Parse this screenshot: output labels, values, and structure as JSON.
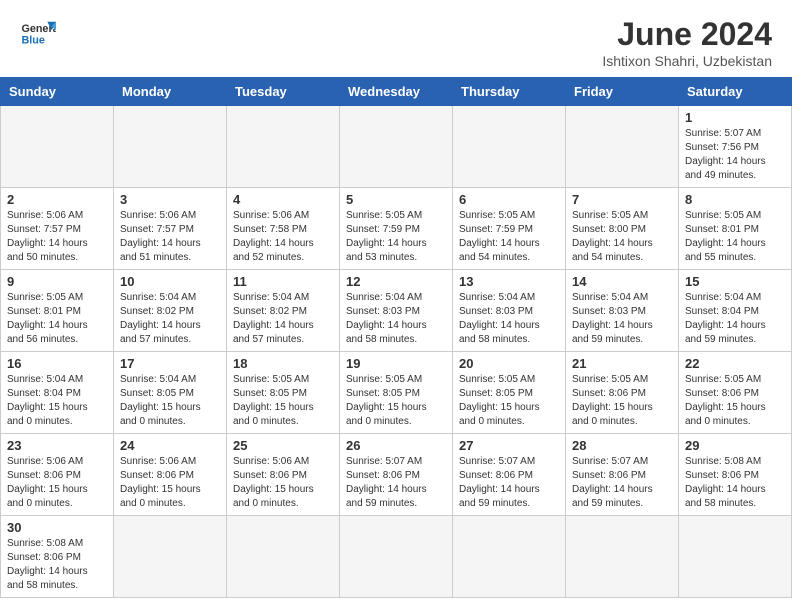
{
  "header": {
    "logo_general": "General",
    "logo_blue": "Blue",
    "title": "June 2024",
    "subtitle": "Ishtixon Shahri, Uzbekistan"
  },
  "weekdays": [
    "Sunday",
    "Monday",
    "Tuesday",
    "Wednesday",
    "Thursday",
    "Friday",
    "Saturday"
  ],
  "weeks": [
    [
      {
        "day": "",
        "info": ""
      },
      {
        "day": "",
        "info": ""
      },
      {
        "day": "",
        "info": ""
      },
      {
        "day": "",
        "info": ""
      },
      {
        "day": "",
        "info": ""
      },
      {
        "day": "",
        "info": ""
      },
      {
        "day": "1",
        "info": "Sunrise: 5:07 AM\nSunset: 7:56 PM\nDaylight: 14 hours and 49 minutes."
      }
    ],
    [
      {
        "day": "2",
        "info": "Sunrise: 5:06 AM\nSunset: 7:57 PM\nDaylight: 14 hours and 50 minutes."
      },
      {
        "day": "3",
        "info": "Sunrise: 5:06 AM\nSunset: 7:57 PM\nDaylight: 14 hours and 51 minutes."
      },
      {
        "day": "4",
        "info": "Sunrise: 5:06 AM\nSunset: 7:58 PM\nDaylight: 14 hours and 52 minutes."
      },
      {
        "day": "5",
        "info": "Sunrise: 5:05 AM\nSunset: 7:59 PM\nDaylight: 14 hours and 53 minutes."
      },
      {
        "day": "6",
        "info": "Sunrise: 5:05 AM\nSunset: 7:59 PM\nDaylight: 14 hours and 54 minutes."
      },
      {
        "day": "7",
        "info": "Sunrise: 5:05 AM\nSunset: 8:00 PM\nDaylight: 14 hours and 54 minutes."
      },
      {
        "day": "8",
        "info": "Sunrise: 5:05 AM\nSunset: 8:01 PM\nDaylight: 14 hours and 55 minutes."
      }
    ],
    [
      {
        "day": "9",
        "info": "Sunrise: 5:05 AM\nSunset: 8:01 PM\nDaylight: 14 hours and 56 minutes."
      },
      {
        "day": "10",
        "info": "Sunrise: 5:04 AM\nSunset: 8:02 PM\nDaylight: 14 hours and 57 minutes."
      },
      {
        "day": "11",
        "info": "Sunrise: 5:04 AM\nSunset: 8:02 PM\nDaylight: 14 hours and 57 minutes."
      },
      {
        "day": "12",
        "info": "Sunrise: 5:04 AM\nSunset: 8:03 PM\nDaylight: 14 hours and 58 minutes."
      },
      {
        "day": "13",
        "info": "Sunrise: 5:04 AM\nSunset: 8:03 PM\nDaylight: 14 hours and 58 minutes."
      },
      {
        "day": "14",
        "info": "Sunrise: 5:04 AM\nSunset: 8:03 PM\nDaylight: 14 hours and 59 minutes."
      },
      {
        "day": "15",
        "info": "Sunrise: 5:04 AM\nSunset: 8:04 PM\nDaylight: 14 hours and 59 minutes."
      }
    ],
    [
      {
        "day": "16",
        "info": "Sunrise: 5:04 AM\nSunset: 8:04 PM\nDaylight: 15 hours and 0 minutes."
      },
      {
        "day": "17",
        "info": "Sunrise: 5:04 AM\nSunset: 8:05 PM\nDaylight: 15 hours and 0 minutes."
      },
      {
        "day": "18",
        "info": "Sunrise: 5:05 AM\nSunset: 8:05 PM\nDaylight: 15 hours and 0 minutes."
      },
      {
        "day": "19",
        "info": "Sunrise: 5:05 AM\nSunset: 8:05 PM\nDaylight: 15 hours and 0 minutes."
      },
      {
        "day": "20",
        "info": "Sunrise: 5:05 AM\nSunset: 8:05 PM\nDaylight: 15 hours and 0 minutes."
      },
      {
        "day": "21",
        "info": "Sunrise: 5:05 AM\nSunset: 8:06 PM\nDaylight: 15 hours and 0 minutes."
      },
      {
        "day": "22",
        "info": "Sunrise: 5:05 AM\nSunset: 8:06 PM\nDaylight: 15 hours and 0 minutes."
      }
    ],
    [
      {
        "day": "23",
        "info": "Sunrise: 5:06 AM\nSunset: 8:06 PM\nDaylight: 15 hours and 0 minutes."
      },
      {
        "day": "24",
        "info": "Sunrise: 5:06 AM\nSunset: 8:06 PM\nDaylight: 15 hours and 0 minutes."
      },
      {
        "day": "25",
        "info": "Sunrise: 5:06 AM\nSunset: 8:06 PM\nDaylight: 15 hours and 0 minutes."
      },
      {
        "day": "26",
        "info": "Sunrise: 5:07 AM\nSunset: 8:06 PM\nDaylight: 14 hours and 59 minutes."
      },
      {
        "day": "27",
        "info": "Sunrise: 5:07 AM\nSunset: 8:06 PM\nDaylight: 14 hours and 59 minutes."
      },
      {
        "day": "28",
        "info": "Sunrise: 5:07 AM\nSunset: 8:06 PM\nDaylight: 14 hours and 59 minutes."
      },
      {
        "day": "29",
        "info": "Sunrise: 5:08 AM\nSunset: 8:06 PM\nDaylight: 14 hours and 58 minutes."
      }
    ],
    [
      {
        "day": "30",
        "info": "Sunrise: 5:08 AM\nSunset: 8:06 PM\nDaylight: 14 hours and 58 minutes."
      },
      {
        "day": "",
        "info": ""
      },
      {
        "day": "",
        "info": ""
      },
      {
        "day": "",
        "info": ""
      },
      {
        "day": "",
        "info": ""
      },
      {
        "day": "",
        "info": ""
      },
      {
        "day": "",
        "info": ""
      }
    ]
  ]
}
